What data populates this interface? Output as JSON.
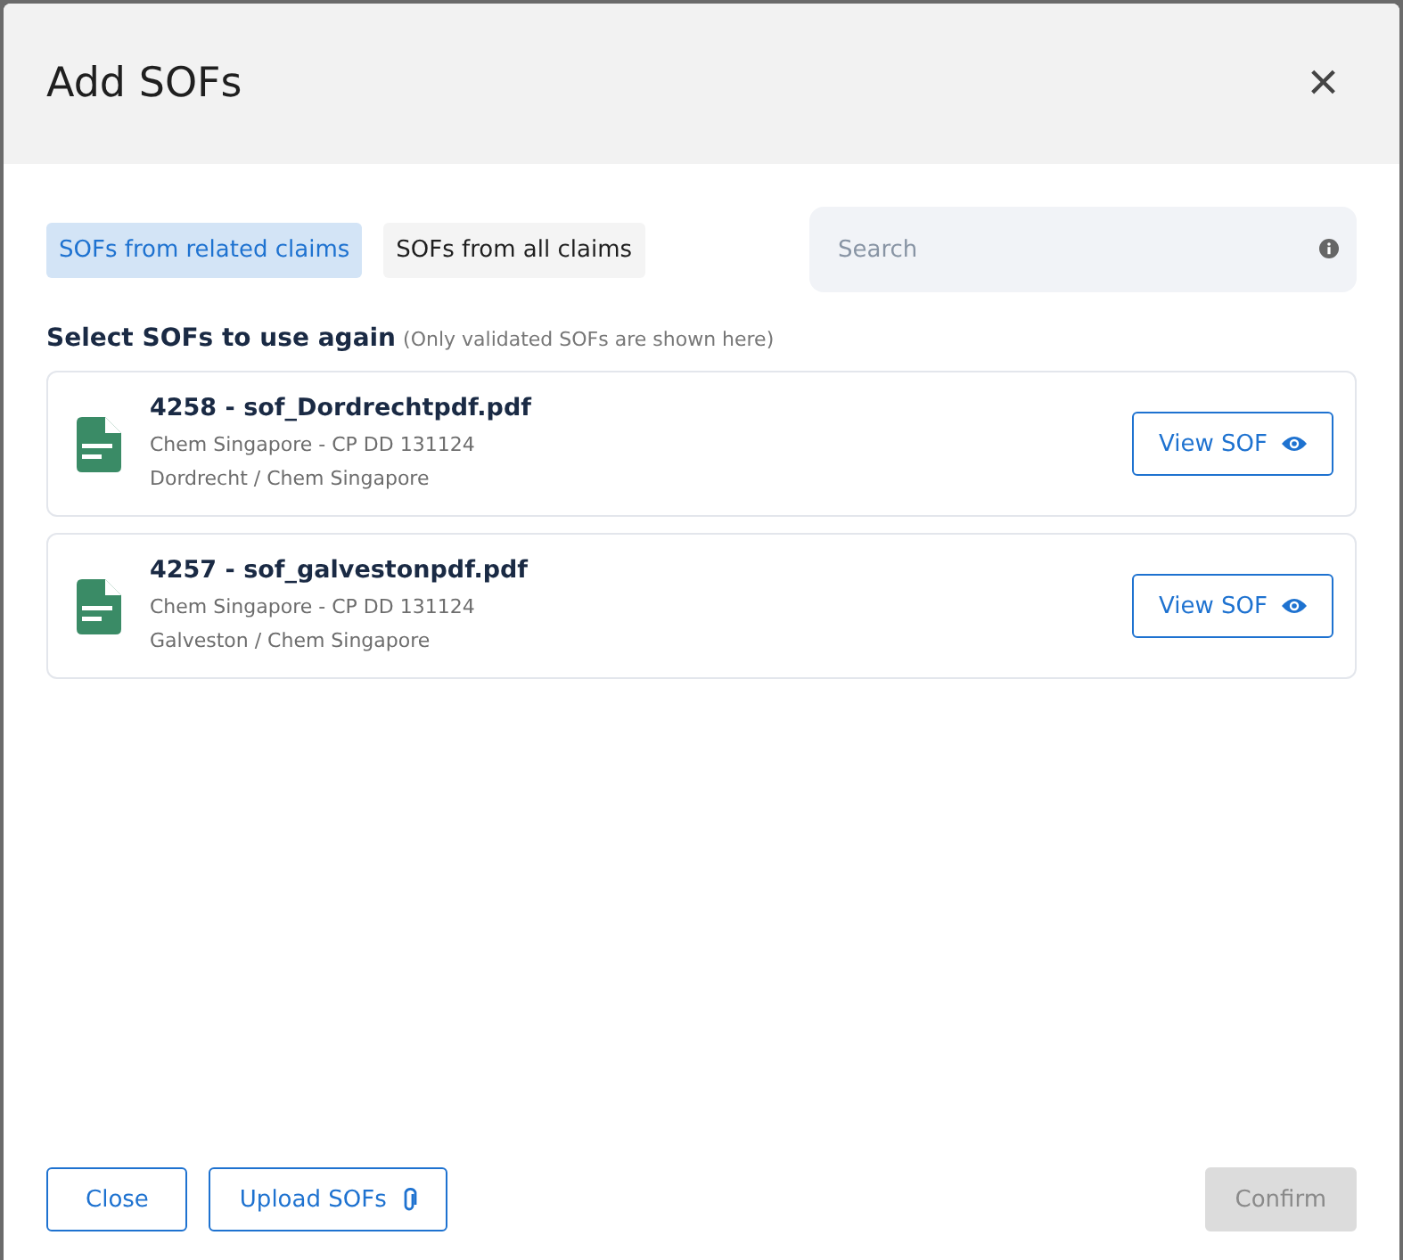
{
  "dialog": {
    "title": "Add SOFs",
    "close_label": "×"
  },
  "tabs": [
    {
      "label": "SOFs from related claims",
      "selected": true
    },
    {
      "label": "SOFs from all claims",
      "selected": false
    }
  ],
  "search": {
    "placeholder": "Search"
  },
  "section": {
    "heading": "Select SOFs to use again",
    "note": "(Only validated SOFs are shown here)"
  },
  "files": [
    {
      "name": "4258 - sof_Dordrechtpdf.pdf",
      "line_1": "Chem Singapore - CP DD 131124",
      "line_2": "Dordrecht / Chem Singapore",
      "action": "View SOF"
    },
    {
      "name": "4257 - sof_galvestonpdf.pdf",
      "line_1": "Chem Singapore - CP DD 131124",
      "line_2": "Galveston / Chem Singapore",
      "action": "View SOF"
    }
  ],
  "footer": {
    "buttons": [
      {
        "label": "Close",
        "kind": "plain",
        "disabled": false
      },
      {
        "label": "Upload SOFs",
        "kind": "attach",
        "disabled": false
      },
      {
        "label": "Confirm",
        "kind": "primary",
        "disabled": true
      }
    ]
  }
}
